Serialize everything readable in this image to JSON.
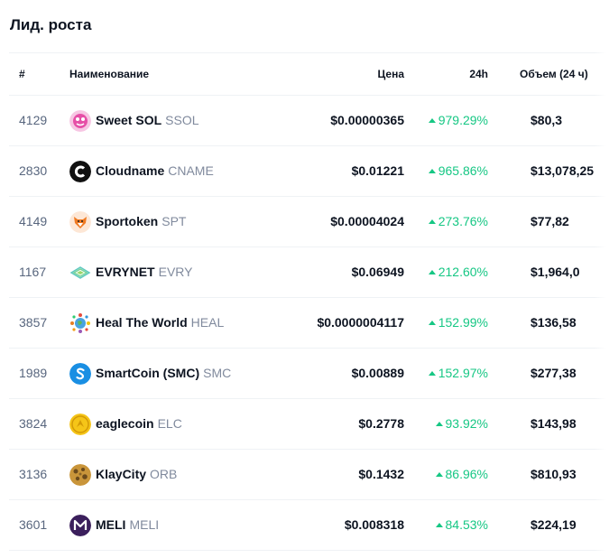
{
  "title": "Лид. роста",
  "headers": {
    "rank": "#",
    "name": "Наименование",
    "price": "Цена",
    "change": "24h",
    "volume": "Объем (24 ч)"
  },
  "accent_green": "#16c784",
  "rows": [
    {
      "rank": "4129",
      "name": "Sweet SOL",
      "symbol": "SSOL",
      "price": "$0.00000365",
      "change": "979.29%",
      "volume": "$80,3",
      "icon": "sweet-sol-icon"
    },
    {
      "rank": "2830",
      "name": "Cloudname",
      "symbol": "CNAME",
      "price": "$0.01221",
      "change": "965.86%",
      "volume": "$13,078,25",
      "icon": "cloudname-icon"
    },
    {
      "rank": "4149",
      "name": "Sportoken",
      "symbol": "SPT",
      "price": "$0.00004024",
      "change": "273.76%",
      "volume": "$77,82",
      "icon": "sportoken-fox-icon"
    },
    {
      "rank": "1167",
      "name": "EVRYNET",
      "symbol": "EVRY",
      "price": "$0.06949",
      "change": "212.60%",
      "volume": "$1,964,0",
      "icon": "evrynet-layers-icon"
    },
    {
      "rank": "3857",
      "name": "Heal The World",
      "symbol": "HEAL",
      "price": "$0.0000004117",
      "change": "152.99%",
      "volume": "$136,58",
      "icon": "heal-the-world-globe-icon"
    },
    {
      "rank": "1989",
      "name": "SmartCoin (SMC)",
      "symbol": "SMC",
      "price": "$0.00889",
      "change": "152.97%",
      "volume": "$277,38",
      "icon": "smartcoin-s-icon"
    },
    {
      "rank": "3824",
      "name": "eaglecoin",
      "symbol": "ELC",
      "price": "$0.2778",
      "change": "93.92%",
      "volume": "$143,98",
      "icon": "eaglecoin-icon"
    },
    {
      "rank": "3136",
      "name": "KlayCity",
      "symbol": "ORB",
      "price": "$0.1432",
      "change": "86.96%",
      "volume": "$810,93",
      "icon": "klaycity-orb-icon"
    },
    {
      "rank": "3601",
      "name": "MELI",
      "symbol": "MELI",
      "price": "$0.008318",
      "change": "84.53%",
      "volume": "$224,19",
      "icon": "meli-icon"
    }
  ]
}
